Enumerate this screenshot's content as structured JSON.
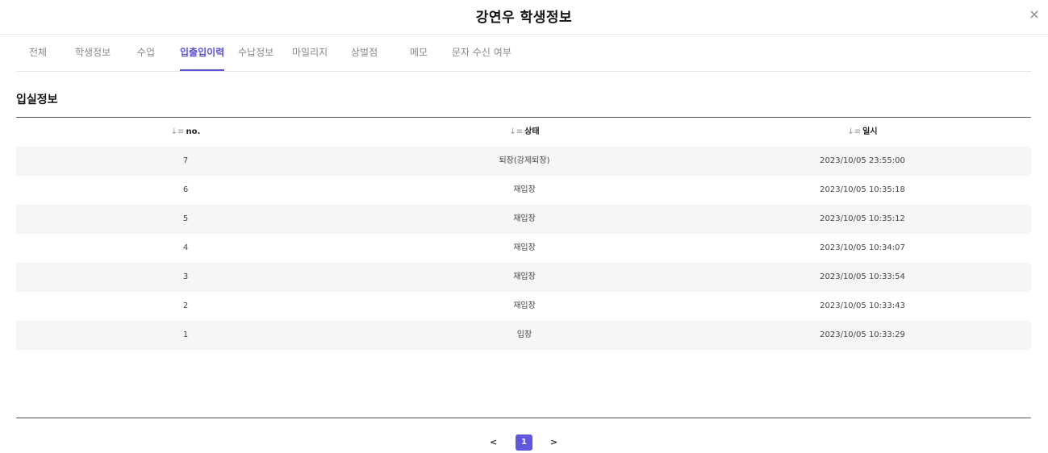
{
  "header": {
    "title": "강연우 학생정보",
    "close_label": "×"
  },
  "tabs": [
    {
      "label": "전체",
      "active": false
    },
    {
      "label": "학생정보",
      "active": false
    },
    {
      "label": "수업",
      "active": false
    },
    {
      "label": "입출입이력",
      "active": true
    },
    {
      "label": "수납정보",
      "active": false
    },
    {
      "label": "마일리지",
      "active": false
    },
    {
      "label": "상벌점",
      "active": false
    },
    {
      "label": "메모",
      "active": false
    },
    {
      "label": "문자 수신 여부",
      "active": false
    }
  ],
  "section": {
    "title": "입실정보"
  },
  "table": {
    "sort_icon": "sort-icon",
    "sort_glyph": "↓≡",
    "columns": [
      "no.",
      "상태",
      "일시"
    ],
    "rows": [
      {
        "no": "7",
        "status": "퇴장(강제퇴장)",
        "datetime": "2023/10/05 23:55:00"
      },
      {
        "no": "6",
        "status": "재입장",
        "datetime": "2023/10/05 10:35:18"
      },
      {
        "no": "5",
        "status": "재입장",
        "datetime": "2023/10/05 10:35:12"
      },
      {
        "no": "4",
        "status": "재입장",
        "datetime": "2023/10/05 10:34:07"
      },
      {
        "no": "3",
        "status": "재입장",
        "datetime": "2023/10/05 10:33:54"
      },
      {
        "no": "2",
        "status": "재입장",
        "datetime": "2023/10/05 10:33:43"
      },
      {
        "no": "1",
        "status": "입장",
        "datetime": "2023/10/05 10:33:29"
      }
    ]
  },
  "pagination": {
    "prev_label": "<",
    "current_page": "1",
    "next_label": ">"
  },
  "colors": {
    "accent": "#5b52d6",
    "page_button": "#5f57e0",
    "row_alt": "#f6f6f6"
  }
}
